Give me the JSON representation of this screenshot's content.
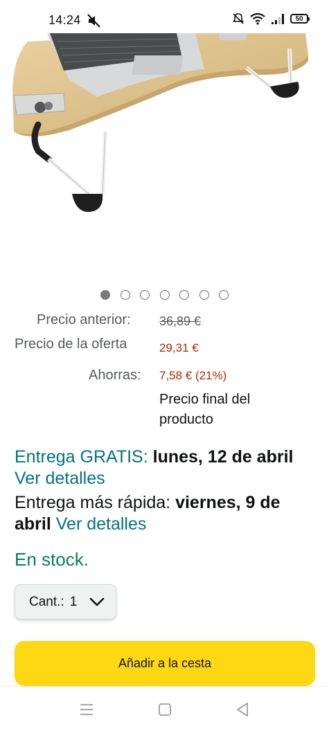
{
  "status_bar": {
    "time": "14:24",
    "battery": "50",
    "icons": [
      "mute-icon",
      "do-not-disturb-icon",
      "wifi-icon",
      "signal-icon",
      "battery-icon"
    ]
  },
  "product_image": {
    "subject": "laptop-tray-table-image"
  },
  "carousel": {
    "count": 7,
    "active_index": 0
  },
  "price": {
    "previous_label": "Precio anterior:",
    "previous_value": "36,89 €",
    "deal_label": "Precio de la oferta",
    "deal_value": "29,31 €",
    "savings_label": "Ahorras:",
    "savings_value": "7,58 € (21%)",
    "final_note": "Precio final del producto"
  },
  "delivery": {
    "free_label": "Entrega GRATIS:",
    "free_date": "lunes, 12 de abril",
    "details_link_1": "Ver detalles",
    "fast_label": "Entrega más rápida:",
    "fast_date": "viernes, 9 de abril",
    "details_link_2": "Ver detalles"
  },
  "stock": {
    "status": "En stock."
  },
  "quantity": {
    "label": "Cant.:",
    "value": "1"
  },
  "actions": {
    "add_to_cart": "Añadir a la cesta"
  },
  "colors": {
    "teal_link": "#007185",
    "price_red": "#b12704",
    "stock_green": "#067d62",
    "cart_yellow": "#ffd814"
  }
}
